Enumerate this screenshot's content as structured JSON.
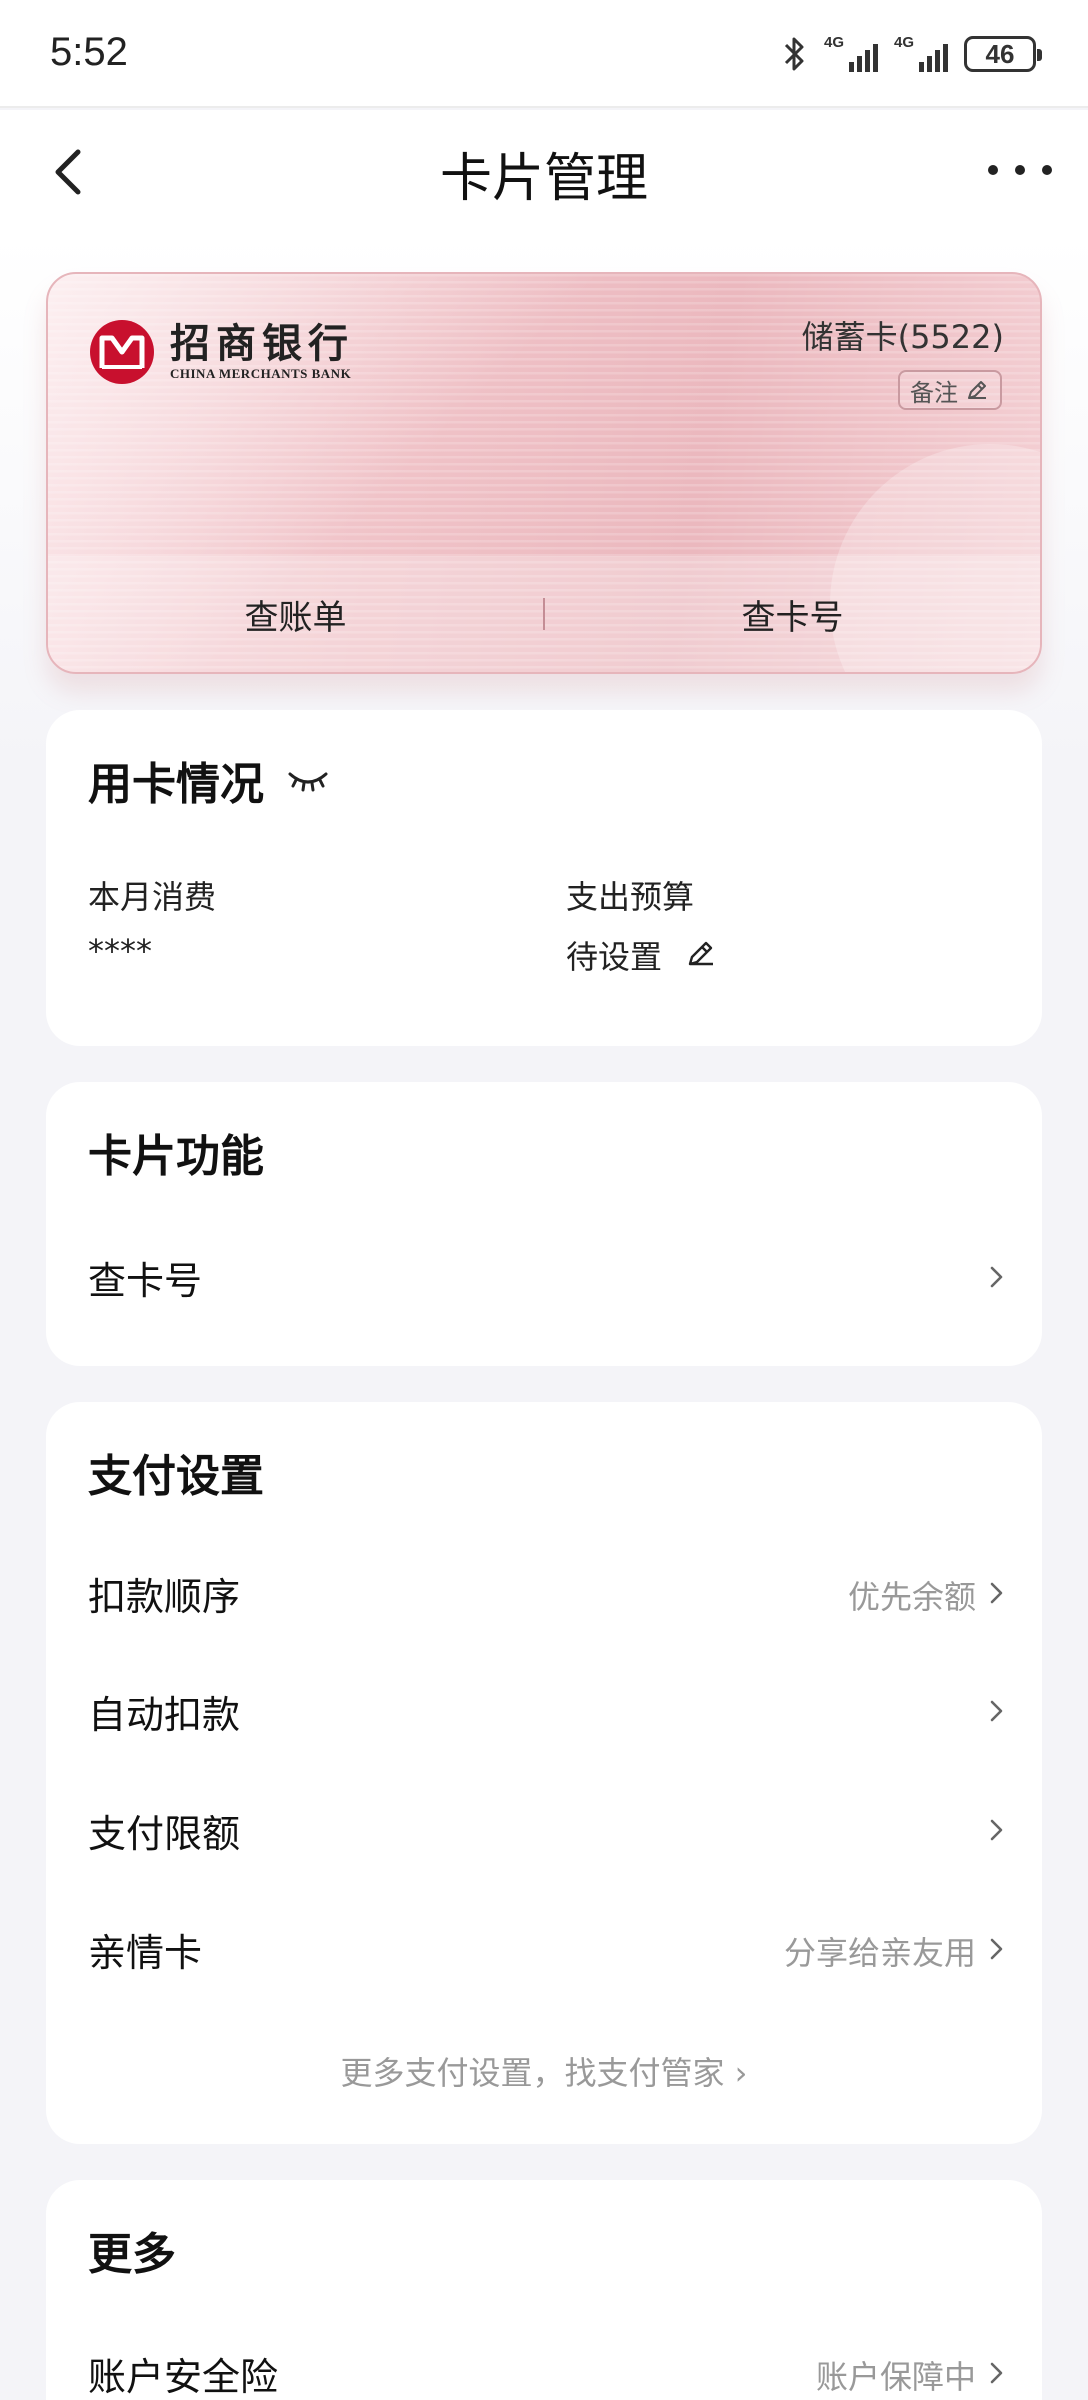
{
  "status": {
    "time": "5:52",
    "net1": "4G",
    "net2": "4G",
    "battery": "46"
  },
  "nav": {
    "title": "卡片管理"
  },
  "card": {
    "bank_name_cn": "招商银行",
    "bank_name_en": "CHINA MERCHANTS BANK",
    "type": "储蓄卡(5522)",
    "note_label": "备注",
    "actions": [
      "查账单",
      "查卡号"
    ],
    "accent_color": "#c8102e"
  },
  "usage": {
    "title": "用卡情况",
    "monthly_label": "本月消费",
    "monthly_value": "****",
    "budget_label": "支出预算",
    "budget_value": "待设置"
  },
  "card_functions": {
    "title": "卡片功能",
    "items": [
      {
        "label": "查卡号",
        "value": ""
      }
    ]
  },
  "payment_settings": {
    "title": "支付设置",
    "items": [
      {
        "label": "扣款顺序",
        "value": "优先余额"
      },
      {
        "label": "自动扣款",
        "value": ""
      },
      {
        "label": "支付限额",
        "value": ""
      },
      {
        "label": "亲情卡",
        "value": "分享给亲友用"
      }
    ],
    "more_link": "更多支付设置，找支付管家 ›"
  },
  "more": {
    "title": "更多",
    "items": [
      {
        "label": "账户安全险",
        "value": "账户保障中"
      }
    ]
  }
}
